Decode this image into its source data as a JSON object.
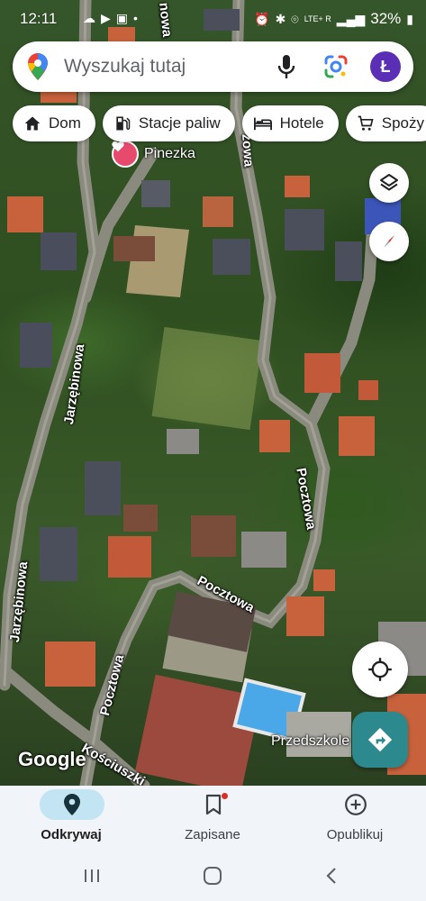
{
  "status_bar": {
    "time": "12:11",
    "left_icons": [
      "cloud-icon",
      "youtube-icon",
      "gallery-icon",
      "dot-icon"
    ],
    "network": "LTE+ R",
    "battery": "32%"
  },
  "search": {
    "placeholder": "Wyszukaj tutaj",
    "avatar_letter": "Ł"
  },
  "chips": [
    {
      "label": "Dom",
      "icon": "home-icon"
    },
    {
      "label": "Stacje paliw",
      "icon": "gas-station-icon"
    },
    {
      "label": "Hotele",
      "icon": "bed-icon"
    },
    {
      "label": "Spoży",
      "icon": "cart-icon"
    }
  ],
  "map": {
    "saved_pin_label": "Pinezka",
    "streets": {
      "jarzebinowa_1": "Jarzębinowa",
      "jarzebinowa_2": "Jarzębinowa",
      "pocztowa_1": "Pocztowa",
      "pocztowa_2": "Pocztowa",
      "pocztowa_3": "Pocztowa",
      "kosciuszki": "Kościuszki",
      "top_1": "nowa",
      "top_2": "zowa"
    },
    "poi_label": "Przedszkole",
    "logo": "Google"
  },
  "bottom_nav": [
    {
      "label": "Odkrywaj",
      "icon": "explore-pin-icon",
      "active": true
    },
    {
      "label": "Zapisane",
      "icon": "bookmark-icon",
      "active": false
    },
    {
      "label": "Opublikuj",
      "icon": "add-circle-icon",
      "active": false
    }
  ],
  "colors": {
    "accent": "#2c8a8f",
    "active_nav": "#c3e4f2",
    "avatar": "#5a2fb5",
    "saved_pin": "#e84a6e"
  }
}
